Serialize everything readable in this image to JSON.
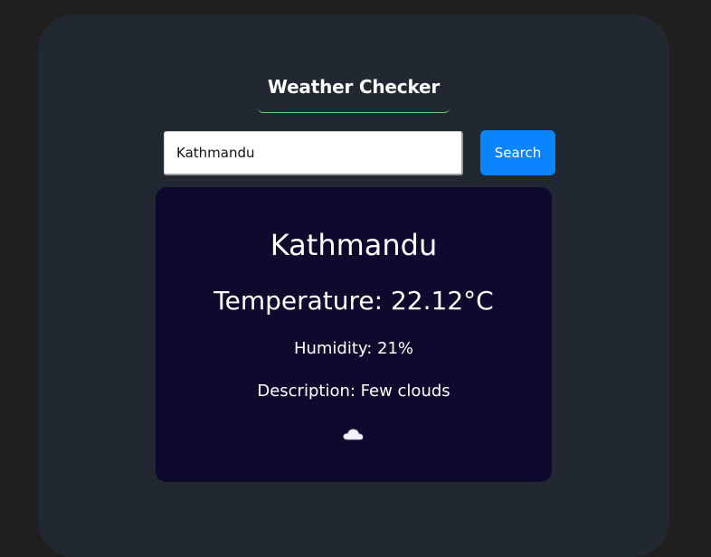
{
  "app": {
    "title": "Weather Checker"
  },
  "search": {
    "value": "Kathmandu",
    "button_label": "Search"
  },
  "weather": {
    "city": "Kathmandu",
    "temperature": "Temperature: 22.12°C",
    "humidity": "Humidity: 21%",
    "description": "Description: Few clouds",
    "icon": "cloud-icon"
  },
  "colors": {
    "page_background": "#1f1f1f",
    "card_background": "#222831",
    "panel_background": "#0d0a2e",
    "accent_button": "#0a84ff",
    "title_underline": "#5fd06a"
  }
}
